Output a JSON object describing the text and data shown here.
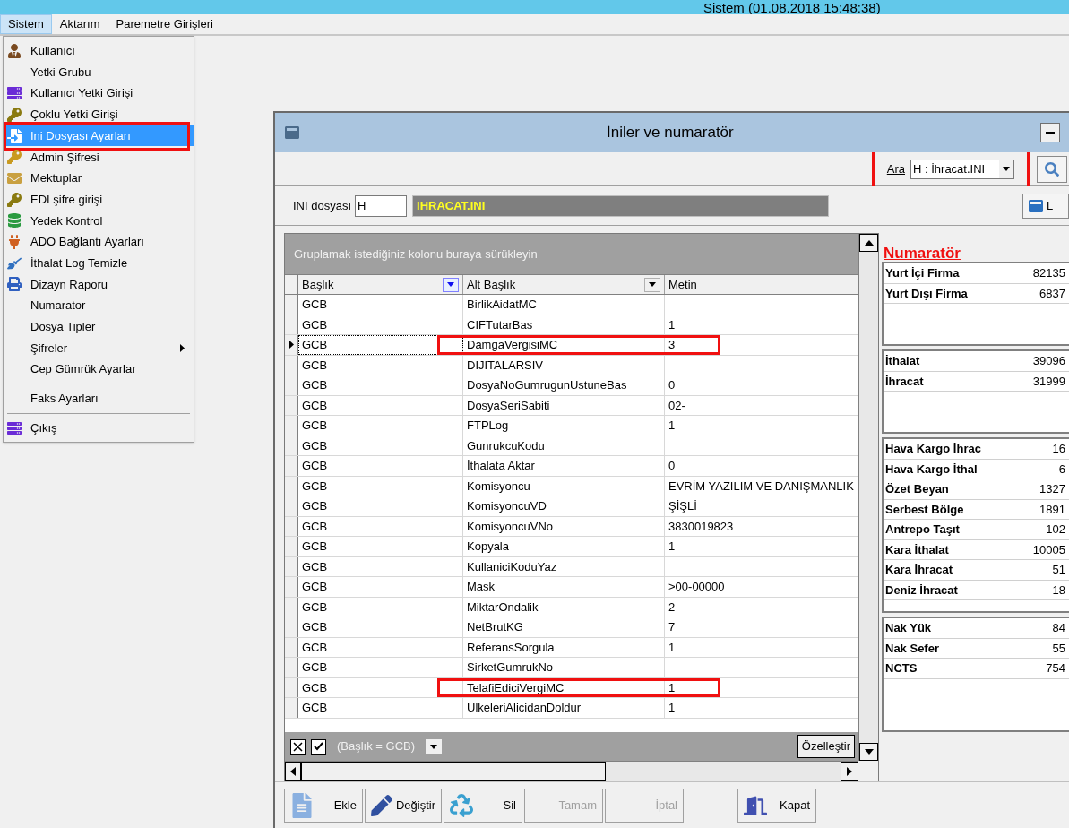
{
  "app_title": "Sistem (01.08.2018 15:48:38)",
  "menu_bar": [
    {
      "label": "Sistem",
      "selected": true
    },
    {
      "label": "Aktarım",
      "selected": false
    },
    {
      "label": "Paremetre Girişleri",
      "selected": false
    }
  ],
  "menu": {
    "items": [
      {
        "kind": "item",
        "label": "Kullanıcı",
        "icon": true,
        "selected": false,
        "highlighted": false,
        "submenu": false
      },
      {
        "kind": "item",
        "label": "Yetki Grubu",
        "icon": false,
        "selected": false,
        "highlighted": false,
        "submenu": false
      },
      {
        "kind": "item",
        "label": "Kullanıcı Yetki Girişi",
        "icon": true,
        "selected": false,
        "highlighted": false,
        "submenu": false
      },
      {
        "kind": "item",
        "label": "Çoklu Yetki Girişi",
        "icon": true,
        "selected": false,
        "highlighted": false,
        "submenu": false
      },
      {
        "kind": "item",
        "label": "Ini Dosyası  Ayarları",
        "icon": true,
        "selected": true,
        "highlighted": true,
        "submenu": false
      },
      {
        "kind": "item",
        "label": "Admin Şifresi",
        "icon": true,
        "selected": false,
        "highlighted": false,
        "submenu": false
      },
      {
        "kind": "item",
        "label": "Mektuplar",
        "icon": true,
        "selected": false,
        "highlighted": false,
        "submenu": false
      },
      {
        "kind": "item",
        "label": "EDI şifre girişi",
        "icon": true,
        "selected": false,
        "highlighted": false,
        "submenu": false
      },
      {
        "kind": "item",
        "label": "Yedek Kontrol",
        "icon": true,
        "selected": false,
        "highlighted": false,
        "submenu": false
      },
      {
        "kind": "item",
        "label": "ADO Bağlantı Ayarları",
        "icon": true,
        "selected": false,
        "highlighted": false,
        "submenu": false
      },
      {
        "kind": "item",
        "label": "İthalat Log Temizle",
        "icon": true,
        "selected": false,
        "highlighted": false,
        "submenu": false
      },
      {
        "kind": "item",
        "label": "Dizayn Raporu",
        "icon": true,
        "selected": false,
        "highlighted": false,
        "submenu": false
      },
      {
        "kind": "item",
        "label": "Numarator",
        "icon": false,
        "selected": false,
        "highlighted": false,
        "submenu": false
      },
      {
        "kind": "item",
        "label": "Dosya Tipler",
        "icon": false,
        "selected": false,
        "highlighted": false,
        "submenu": false
      },
      {
        "kind": "item",
        "label": "Şifreler",
        "icon": false,
        "selected": false,
        "highlighted": false,
        "submenu": true
      },
      {
        "kind": "item",
        "label": "Cep Gümrük Ayarlar",
        "icon": false,
        "selected": false,
        "highlighted": false,
        "submenu": false
      },
      {
        "kind": "separator"
      },
      {
        "kind": "item",
        "label": "Faks Ayarları",
        "icon": false,
        "selected": false,
        "highlighted": false,
        "submenu": false
      },
      {
        "kind": "separator"
      },
      {
        "kind": "item",
        "label": "Çıkış",
        "icon": true,
        "selected": false,
        "highlighted": false,
        "submenu": false
      }
    ]
  },
  "window": {
    "title": "İniler ve numaratör",
    "search": {
      "label": "Ara",
      "value": "H : İhracat.INI",
      "highlighted": true
    },
    "side_button": {
      "label": "L"
    },
    "ini_file": {
      "label": "INI dosyası",
      "value": "H",
      "name": "IHRACAT.INI"
    },
    "grid": {
      "group_hint": "Gruplamak istediğiniz kolonu buraya sürükleyin",
      "columns": [
        {
          "label": "Başlık",
          "filter": true,
          "filter_active": true
        },
        {
          "label": "Alt Başlık",
          "filter": true,
          "filter_active": false
        },
        {
          "label": "Metin",
          "filter": false
        }
      ],
      "rows": [
        {
          "cells": [
            "GCB",
            "BirlikAidatMC",
            ""
          ],
          "selected": false,
          "highlighted": false
        },
        {
          "cells": [
            "GCB",
            "CIFTutarBas",
            "1"
          ],
          "selected": false,
          "highlighted": false
        },
        {
          "cells": [
            "GCB",
            "DamgaVergisiMC",
            "3"
          ],
          "selected": true,
          "highlighted": true
        },
        {
          "cells": [
            "GCB",
            "DIJITALARSIV",
            ""
          ],
          "selected": false,
          "highlighted": false
        },
        {
          "cells": [
            "GCB",
            "DosyaNoGumrugunUstuneBas",
            "0"
          ],
          "selected": false,
          "highlighted": false
        },
        {
          "cells": [
            "GCB",
            "DosyaSeriSabiti",
            "02-"
          ],
          "selected": false,
          "highlighted": false
        },
        {
          "cells": [
            "GCB",
            "FTPLog",
            "1"
          ],
          "selected": false,
          "highlighted": false
        },
        {
          "cells": [
            "GCB",
            "GunrukcuKodu",
            ""
          ],
          "selected": false,
          "highlighted": false
        },
        {
          "cells": [
            "GCB",
            "İthalata Aktar",
            "0"
          ],
          "selected": false,
          "highlighted": false
        },
        {
          "cells": [
            "GCB",
            "Komisyoncu",
            "EVRİM YAZILIM VE DANIŞMANLIK"
          ],
          "selected": false,
          "highlighted": false
        },
        {
          "cells": [
            "GCB",
            "KomisyoncuVD",
            "ŞİŞLİ"
          ],
          "selected": false,
          "highlighted": false
        },
        {
          "cells": [
            "GCB",
            "KomisyoncuVNo",
            "3830019823"
          ],
          "selected": false,
          "highlighted": false
        },
        {
          "cells": [
            "GCB",
            "Kopyala",
            "1"
          ],
          "selected": false,
          "highlighted": false
        },
        {
          "cells": [
            "GCB",
            "KullaniciKoduYaz",
            ""
          ],
          "selected": false,
          "highlighted": false
        },
        {
          "cells": [
            "GCB",
            "Mask",
            ">00-00000"
          ],
          "selected": false,
          "highlighted": false
        },
        {
          "cells": [
            "GCB",
            "MiktarOndalik",
            "2"
          ],
          "selected": false,
          "highlighted": false
        },
        {
          "cells": [
            "GCB",
            "NetBrutKG",
            "7"
          ],
          "selected": false,
          "highlighted": false
        },
        {
          "cells": [
            "GCB",
            "ReferansSorgula",
            "1"
          ],
          "selected": false,
          "highlighted": false
        },
        {
          "cells": [
            "GCB",
            "SirketGumrukNo",
            ""
          ],
          "selected": false,
          "highlighted": false
        },
        {
          "cells": [
            "GCB",
            "TelafiEdiciVergiMC",
            "1"
          ],
          "selected": false,
          "highlighted": true
        },
        {
          "cells": [
            "GCB",
            "UlkeleriAlicidanDoldur",
            "1"
          ],
          "selected": false,
          "highlighted": false
        }
      ],
      "filter": {
        "enabled": true,
        "text": "(Başlık = GCB)",
        "customize": "Özelleştir"
      }
    },
    "numerator": {
      "title": "Numaratör",
      "groups": [
        {
          "rows": [
            {
              "label": "Yurt İçi Firma",
              "value": "82135"
            },
            {
              "label": "Yurt Dışı Firma",
              "value": "6837"
            }
          ]
        },
        {
          "rows": [
            {
              "label": "İthalat",
              "value": "39096"
            },
            {
              "label": "İhracat",
              "value": "31999"
            }
          ]
        },
        {
          "rows": [
            {
              "label": "Hava Kargo İhrac",
              "value": "16"
            },
            {
              "label": "Hava Kargo İthal",
              "value": "6"
            },
            {
              "label": "Özet Beyan",
              "value": "1327"
            },
            {
              "label": "Serbest Bölge",
              "value": "1891"
            },
            {
              "label": "Antrepo Taşıt",
              "value": "102"
            },
            {
              "label": "Kara İthalat",
              "value": "10005"
            },
            {
              "label": "Kara İhracat",
              "value": "51"
            },
            {
              "label": "Deniz İhracat",
              "value": "18"
            }
          ]
        },
        {
          "rows": [
            {
              "label": "Nak Yük",
              "value": "84"
            },
            {
              "label": "Nak Sefer",
              "value": "55"
            },
            {
              "label": "NCTS",
              "value": "754"
            }
          ]
        }
      ]
    },
    "buttons": [
      {
        "label": "Ekle",
        "disabled": false
      },
      {
        "label": "Değiştir",
        "disabled": false
      },
      {
        "label": "Sil",
        "disabled": false
      },
      {
        "label": "Tamam",
        "disabled": true
      },
      {
        "label": "İptal",
        "disabled": true
      },
      {
        "label": "Kapat",
        "disabled": false
      }
    ]
  }
}
